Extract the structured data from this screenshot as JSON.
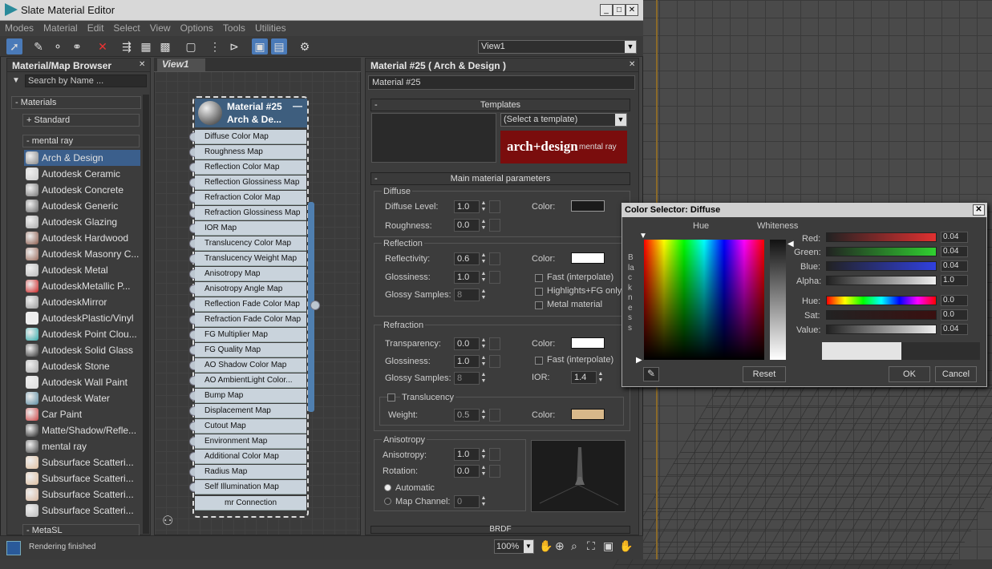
{
  "window": {
    "title": "Slate Material Editor",
    "min": "_",
    "max": "□",
    "close": "✕"
  },
  "menu": [
    "Modes",
    "Material",
    "Edit",
    "Select",
    "View",
    "Options",
    "Tools",
    "Utilities"
  ],
  "view_select": {
    "value": "View1"
  },
  "browser": {
    "title": "Material/Map Browser",
    "search_placeholder": "Search by Name ...",
    "groups": {
      "materials": "- Materials",
      "standard": "+ Standard",
      "mentalray": "- mental ray",
      "metasl": "- MetaSL"
    },
    "items": [
      "Arch & Design",
      "Autodesk Ceramic",
      "Autodesk Concrete",
      "Autodesk Generic",
      "Autodesk Glazing",
      "Autodesk Hardwood",
      "Autodesk Masonry C...",
      "Autodesk Metal",
      "AutodeskMetallic P...",
      "AutodeskMirror",
      "AutodeskPlastic/Vinyl",
      "Autodesk Point Clou...",
      "Autodesk Solid Glass",
      "Autodesk Stone",
      "Autodesk Wall Paint",
      "Autodesk Water",
      "Car Paint",
      "Matte/Shadow/Refle...",
      "mental ray",
      "Subsurface Scatteri...",
      "Subsurface Scatteri...",
      "Subsurface Scatteri...",
      "Subsurface Scatteri..."
    ]
  },
  "view1": {
    "tab": "View1",
    "node_title1": "Material #25",
    "node_title2": "Arch & De...",
    "slots": [
      "Diffuse Color Map",
      "Roughness Map",
      "Reflection Color Map",
      "Reflection Glossiness Map",
      "Refraction Color Map",
      "Refraction Glossiness Map",
      "IOR Map",
      "Translucency Color Map",
      "Translucency Weight Map",
      "Anisotropy Map",
      "Anisotropy Angle Map",
      "Reflection Fade Color Map",
      "Refraction Fade Color Map",
      "FG Multiplier Map",
      "FG Quality Map",
      "AO Shadow Color Map",
      "AO AmbientLight Color...",
      "Bump Map",
      "Displacement Map",
      "Cutout Map",
      "Environment Map",
      "Additional Color Map",
      "Radius Map",
      "Self Illumination Map"
    ],
    "connection": "mr Connection"
  },
  "params": {
    "title": "Material #25  ( Arch & Design )",
    "name": "Material #25",
    "templates": "Templates",
    "template_select": "(Select a template)",
    "logo_main": "arch+design",
    "logo_sub": "mental ray",
    "main": "Main material parameters",
    "diffuse": {
      "title": "Diffuse",
      "level_label": "Diffuse Level:",
      "level": "1.0",
      "rough_label": "Roughness:",
      "rough": "0.0",
      "color_label": "Color:"
    },
    "reflection": {
      "title": "Reflection",
      "refl_label": "Reflectivity:",
      "refl": "0.6",
      "gloss_label": "Glossiness:",
      "gloss": "1.0",
      "samples_label": "Glossy Samples:",
      "samples": "8",
      "color_label": "Color:",
      "fast": "Fast (interpolate)",
      "highlights": "Highlights+FG only",
      "metal": "Metal material"
    },
    "refraction": {
      "title": "Refraction",
      "trans_label": "Transparency:",
      "trans": "0.0",
      "gloss_label": "Glossiness:",
      "gloss": "1.0",
      "samples_label": "Glossy Samples:",
      "samples": "8",
      "color_label": "Color:",
      "fast": "Fast (interpolate)",
      "ior_label": "IOR:",
      "ior": "1.4",
      "transl": "Translucency",
      "weight_label": "Weight:",
      "weight": "0.5",
      "tcolor_label": "Color:"
    },
    "anisotropy": {
      "title": "Anisotropy",
      "aniso_label": "Anisotropy:",
      "aniso": "1.0",
      "rot_label": "Rotation:",
      "rot": "0.0",
      "auto": "Automatic",
      "mapch": "Map Channel:",
      "mapch_val": "0"
    },
    "brdf": "BRDF"
  },
  "color_selector": {
    "title": "Color Selector: Diffuse",
    "hue": "Hue",
    "whiteness": "Whiteness",
    "blackness": "Blackness",
    "red_label": "Red:",
    "red": "0.04",
    "green_label": "Green:",
    "green": "0.04",
    "blue_label": "Blue:",
    "blue": "0.04",
    "alpha_label": "Alpha:",
    "alpha": "1.0",
    "hue_label": "Hue:",
    "hue_val": "0.0",
    "sat_label": "Sat:",
    "sat": "0.0",
    "value_label": "Value:",
    "value": "0.04",
    "reset": "Reset",
    "ok": "OK",
    "cancel": "Cancel"
  },
  "status": {
    "text": "Rendering finished",
    "zoom": "100%"
  },
  "colors": {
    "accent": "#3b5f8c",
    "node_header": "#3e5e7e",
    "diffuse_swatch": "#1a1a1a",
    "white_swatch": "#ffffff",
    "translucency_swatch": "#d8b88a"
  }
}
